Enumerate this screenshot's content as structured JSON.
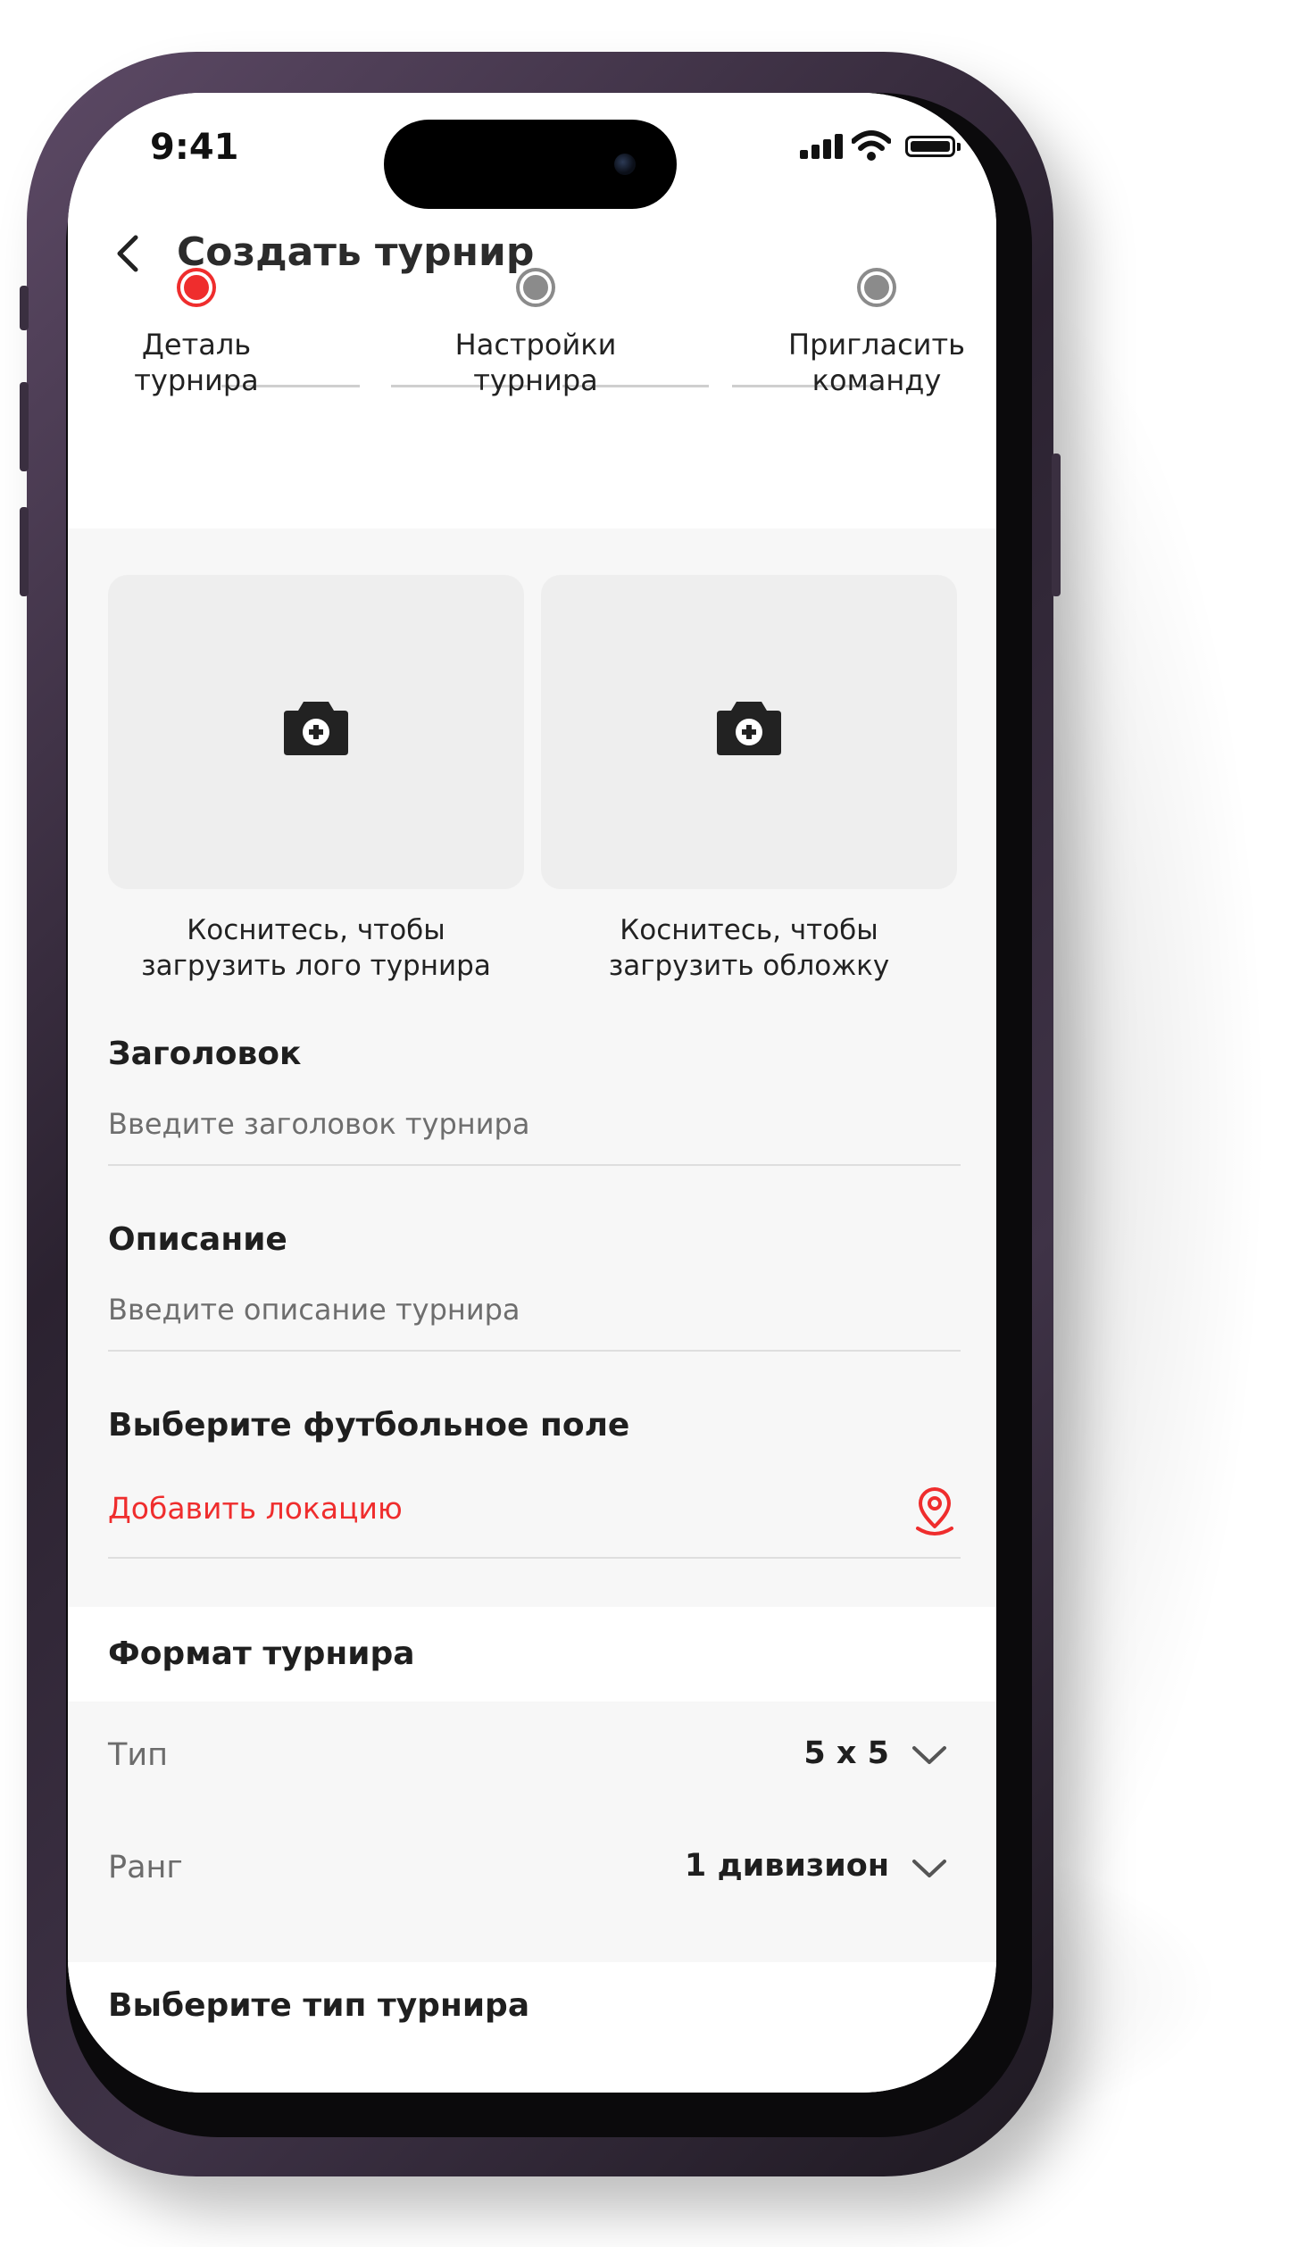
{
  "status_bar": {
    "time": "9:41"
  },
  "header": {
    "title": "Создать турнир"
  },
  "stepper": {
    "steps": [
      {
        "label": "Деталь\nтурнира",
        "active": true
      },
      {
        "label": "Настройки\nтурнира",
        "active": false
      },
      {
        "label": "Пригласить\nкоманду",
        "active": false
      }
    ]
  },
  "uploads": {
    "logo_caption": "Коснитесь, чтобы\nзагрузить лого турнира",
    "cover_caption": "Коснитесь, чтобы\nзагрузить обложку"
  },
  "form": {
    "title_label": "Заголовок",
    "title_placeholder": "Введите заголовок турнира",
    "description_label": "Описание",
    "description_placeholder": "Введите описание турнира",
    "field_label": "Выберите футбольное поле",
    "add_location": "Добавить локацию"
  },
  "format": {
    "heading": "Формат турнира",
    "rows": [
      {
        "label": "Тип",
        "value": "5 x 5"
      },
      {
        "label": "Ранг",
        "value": "1 дивизион"
      }
    ]
  },
  "tournament_type": {
    "heading": "Выберите тип турнира"
  },
  "icons": {
    "back": "chevron-left-icon",
    "upload": "camera-plus-icon",
    "location": "map-pin-icon",
    "dropdown": "chevron-down-icon"
  },
  "colors": {
    "accent": "#ef2d2d",
    "inactive_step": "#8b8b8b",
    "background": "#f7f7f7",
    "tile": "#eeeeee"
  }
}
